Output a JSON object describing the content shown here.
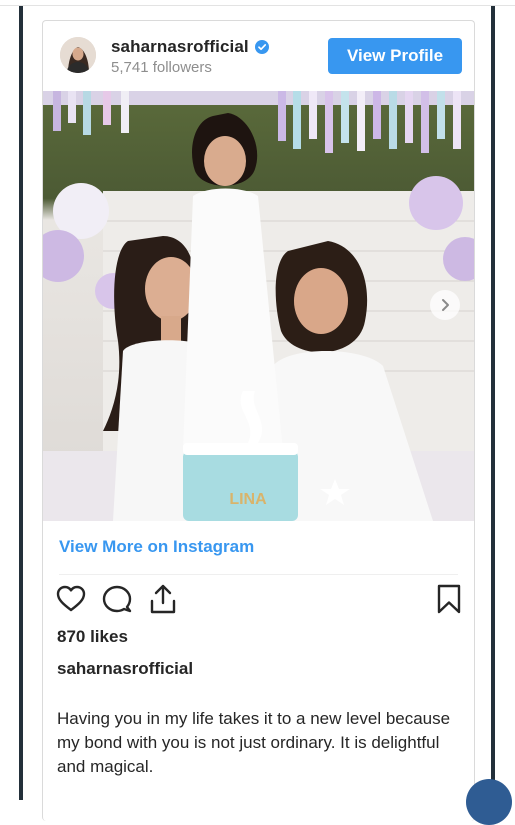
{
  "profile": {
    "username": "saharnasrofficial",
    "followers": "5,741 followers",
    "view_profile_label": "View Profile",
    "verified": true
  },
  "post": {
    "view_more_label": "View More on Instagram",
    "likes": "870 likes",
    "caption_username": "saharnasrofficial",
    "caption": "Having you in my life takes it to a new level because my bond with you is not just ordinary. It is delightful and magical.",
    "cake_text": "LINA"
  },
  "icons": [
    "heart-icon",
    "comment-icon",
    "share-icon",
    "bookmark-icon",
    "verified-badge-icon",
    "chevron-right-icon"
  ],
  "colors": {
    "accent": "#3897f0",
    "text": "#262626",
    "muted": "#8e8e8e",
    "page_bar": "#23303a"
  }
}
